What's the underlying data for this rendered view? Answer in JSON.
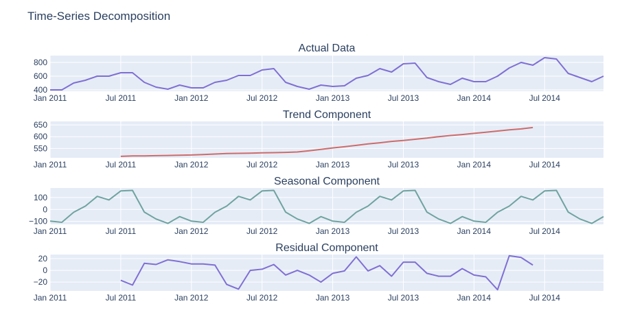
{
  "title": "Time-Series Decomposition",
  "chart_data": [
    {
      "type": "line",
      "title": "Actual Data",
      "color": "#7f6fd4",
      "x_start": "2011-01",
      "x_ticks": [
        "Jan 2011",
        "Jul 2011",
        "Jan 2012",
        "Jul 2012",
        "Jan 2013",
        "Jul 2013",
        "Jan 2014",
        "Jul 2014"
      ],
      "ylim": [
        380,
        900
      ],
      "yticks": [
        400,
        600,
        800
      ],
      "grid": true,
      "x": [
        "2011-01",
        "2011-02",
        "2011-03",
        "2011-04",
        "2011-05",
        "2011-06",
        "2011-07",
        "2011-08",
        "2011-09",
        "2011-10",
        "2011-11",
        "2011-12",
        "2012-01",
        "2012-02",
        "2012-03",
        "2012-04",
        "2012-05",
        "2012-06",
        "2012-07",
        "2012-08",
        "2012-09",
        "2012-10",
        "2012-11",
        "2012-12",
        "2013-01",
        "2013-02",
        "2013-03",
        "2013-04",
        "2013-05",
        "2013-06",
        "2013-07",
        "2013-08",
        "2013-09",
        "2013-10",
        "2013-11",
        "2013-12",
        "2014-01",
        "2014-02",
        "2014-03",
        "2014-04",
        "2014-05",
        "2014-06",
        "2014-07",
        "2014-08",
        "2014-09",
        "2014-10",
        "2014-11",
        "2014-12"
      ],
      "values": [
        400,
        400,
        500,
        540,
        600,
        600,
        650,
        650,
        510,
        440,
        410,
        470,
        430,
        430,
        510,
        540,
        610,
        610,
        690,
        710,
        510,
        450,
        410,
        470,
        450,
        460,
        570,
        610,
        710,
        660,
        780,
        790,
        580,
        520,
        480,
        570,
        520,
        520,
        600,
        720,
        800,
        760,
        870,
        850,
        640,
        580,
        520,
        600
      ]
    },
    {
      "type": "line",
      "title": "Trend Component",
      "color": "#cd6b6b",
      "x_ticks": [
        "Jan 2011",
        "Jul 2011",
        "Jan 2012",
        "Jul 2012",
        "Jan 2013",
        "Jul 2013",
        "Jan 2014",
        "Jul 2014"
      ],
      "ylim": [
        510,
        665
      ],
      "yticks": [
        550,
        600,
        650
      ],
      "grid": true,
      "x": [
        "2011-07",
        "2011-08",
        "2011-09",
        "2011-10",
        "2011-11",
        "2011-12",
        "2012-01",
        "2012-02",
        "2012-03",
        "2012-04",
        "2012-05",
        "2012-06",
        "2012-07",
        "2012-08",
        "2012-09",
        "2012-10",
        "2012-11",
        "2012-12",
        "2013-01",
        "2013-02",
        "2013-03",
        "2013-04",
        "2013-05",
        "2013-06",
        "2013-07",
        "2013-08",
        "2013-09",
        "2013-10",
        "2013-11",
        "2013-12",
        "2014-01",
        "2014-02",
        "2014-03",
        "2014-04",
        "2014-05",
        "2014-06"
      ],
      "values": [
        516,
        518,
        518,
        519,
        520,
        521,
        522,
        524,
        526,
        528,
        529,
        530,
        531,
        532,
        533,
        535,
        540,
        546,
        552,
        557,
        563,
        569,
        574,
        580,
        584,
        589,
        594,
        600,
        605,
        609,
        614,
        619,
        624,
        629,
        633,
        639
      ]
    },
    {
      "type": "line",
      "title": "Seasonal Component",
      "color": "#6fa3a0",
      "x_ticks": [
        "Jan 2011",
        "Jul 2011",
        "Jan 2012",
        "Jul 2012",
        "Jan 2013",
        "Jul 2013",
        "Jan 2014",
        "Jul 2014"
      ],
      "ylim": [
        -125,
        180
      ],
      "yticks": [
        -100,
        0,
        100
      ],
      "grid": true,
      "x": [
        "2011-01",
        "2011-02",
        "2011-03",
        "2011-04",
        "2011-05",
        "2011-06",
        "2011-07",
        "2011-08",
        "2011-09",
        "2011-10",
        "2011-11",
        "2011-12",
        "2012-01",
        "2012-02",
        "2012-03",
        "2012-04",
        "2012-05",
        "2012-06",
        "2012-07",
        "2012-08",
        "2012-09",
        "2012-10",
        "2012-11",
        "2012-12",
        "2013-01",
        "2013-02",
        "2013-03",
        "2013-04",
        "2013-05",
        "2013-06",
        "2013-07",
        "2013-08",
        "2013-09",
        "2013-10",
        "2013-11",
        "2013-12",
        "2014-01",
        "2014-02",
        "2014-03",
        "2014-04",
        "2014-05",
        "2014-06",
        "2014-07",
        "2014-08",
        "2014-09",
        "2014-10",
        "2014-11",
        "2014-12"
      ],
      "values": [
        -98,
        -108,
        -24,
        28,
        110,
        80,
        155,
        160,
        -22,
        -80,
        -117,
        -60,
        -98,
        -108,
        -24,
        28,
        110,
        80,
        155,
        160,
        -22,
        -80,
        -117,
        -60,
        -98,
        -108,
        -24,
        28,
        110,
        80,
        155,
        160,
        -22,
        -80,
        -117,
        -60,
        -98,
        -108,
        -24,
        28,
        110,
        80,
        155,
        160,
        -22,
        -80,
        -117,
        -60
      ]
    },
    {
      "type": "line",
      "title": "Residual Component",
      "color": "#7f6fd4",
      "x_ticks": [
        "Jan 2011",
        "Jul 2011",
        "Jan 2012",
        "Jul 2012",
        "Jan 2013",
        "Jul 2013",
        "Jan 2014",
        "Jul 2014"
      ],
      "ylim": [
        -35,
        27
      ],
      "yticks": [
        -20,
        0,
        20
      ],
      "grid": true,
      "x": [
        "2011-07",
        "2011-08",
        "2011-09",
        "2011-10",
        "2011-11",
        "2011-12",
        "2012-01",
        "2012-02",
        "2012-03",
        "2012-04",
        "2012-05",
        "2012-06",
        "2012-07",
        "2012-08",
        "2012-09",
        "2012-10",
        "2012-11",
        "2012-12",
        "2013-01",
        "2013-02",
        "2013-03",
        "2013-04",
        "2013-05",
        "2013-06",
        "2013-07",
        "2013-08",
        "2013-09",
        "2013-10",
        "2013-11",
        "2013-12",
        "2014-01",
        "2014-02",
        "2014-03",
        "2014-04",
        "2014-05",
        "2014-06"
      ],
      "values": [
        -17,
        -25,
        12,
        10,
        18,
        15,
        11,
        11,
        9,
        -24,
        -32,
        0,
        2,
        10,
        -8,
        0,
        -8,
        -20,
        -5,
        -1,
        23,
        -1,
        8,
        -10,
        14,
        14,
        -5,
        -10,
        -10,
        3,
        -8,
        -11,
        -33,
        25,
        22,
        9
      ]
    }
  ]
}
